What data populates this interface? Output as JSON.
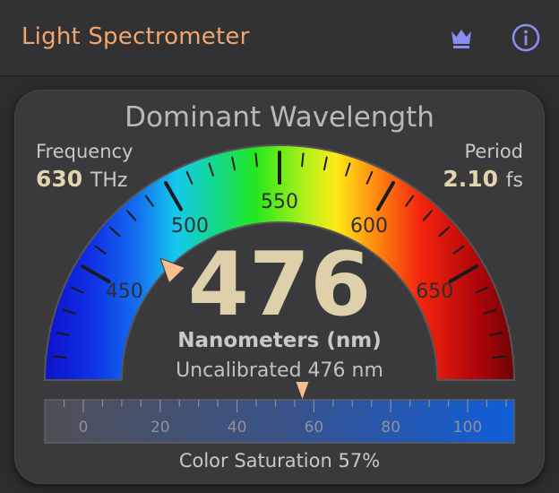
{
  "app": {
    "title": "Light Spectrometer",
    "icons": [
      "crown-icon",
      "info-icon"
    ],
    "accent_color": "#f2a56e",
    "icon_color": "#8c8cf0"
  },
  "card": {
    "title": "Dominant Wavelength"
  },
  "frequency": {
    "label": "Frequency",
    "value": "630",
    "unit": "THz"
  },
  "period": {
    "label": "Period",
    "value": "2.10",
    "unit": "fs"
  },
  "gauge": {
    "min": 400,
    "max": 700,
    "value": 476,
    "tick_labels": [
      "450",
      "500",
      "550",
      "600",
      "650"
    ],
    "marker_color": "#f5bf8e"
  },
  "reading": {
    "value": "476",
    "unit_label": "Nanometers (nm)",
    "uncalibrated": "Uncalibrated 476 nm"
  },
  "saturation": {
    "value": 57,
    "tick_labels": [
      "0",
      "20",
      "40",
      "60",
      "80",
      "100"
    ],
    "label": "Color Saturation 57%"
  }
}
